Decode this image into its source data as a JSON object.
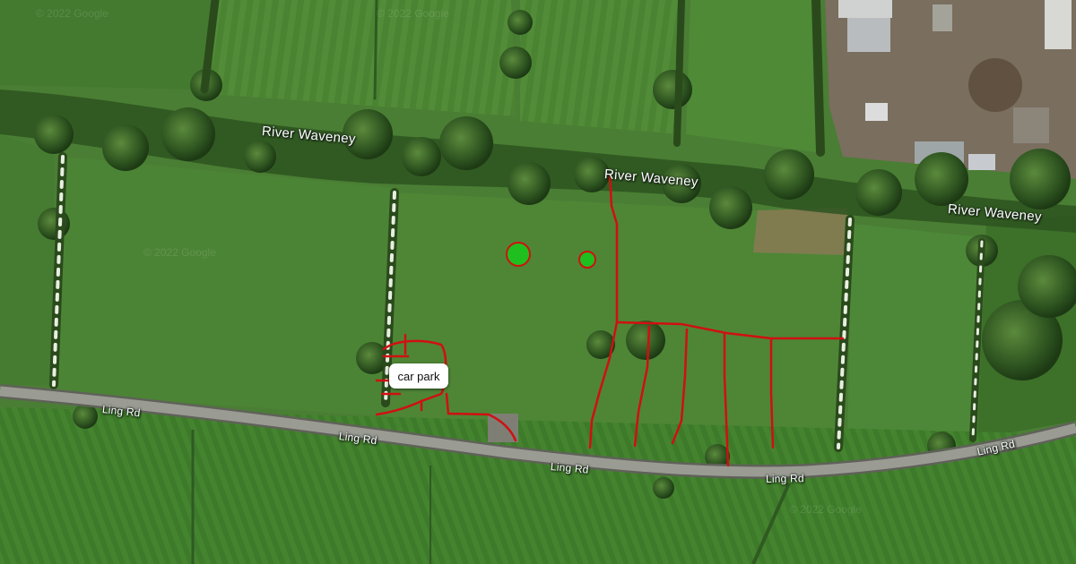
{
  "map": {
    "imagery": "satellite",
    "watermark_text": "© 2022 Google",
    "river_labels": [
      {
        "text": "River Waveney"
      },
      {
        "text": "River Waveney"
      },
      {
        "text": "River Waveney"
      }
    ],
    "road_labels": [
      {
        "text": "Ling Rd"
      },
      {
        "text": "Ling Rd"
      },
      {
        "text": "Ling Rd"
      },
      {
        "text": "Ling Rd"
      },
      {
        "text": "Ling Rd"
      }
    ],
    "annotations": {
      "callout_label": "car park",
      "path_color": "#d01010",
      "marker_color": "#1fbf1f",
      "marker_border_color": "#d01010"
    },
    "colors": {
      "field_light": "#4f8a35",
      "field_dark": "#2f5a22",
      "road": "#8d8f88",
      "hedge": "#2a4a1c",
      "blossom": "#e8efe0"
    }
  }
}
